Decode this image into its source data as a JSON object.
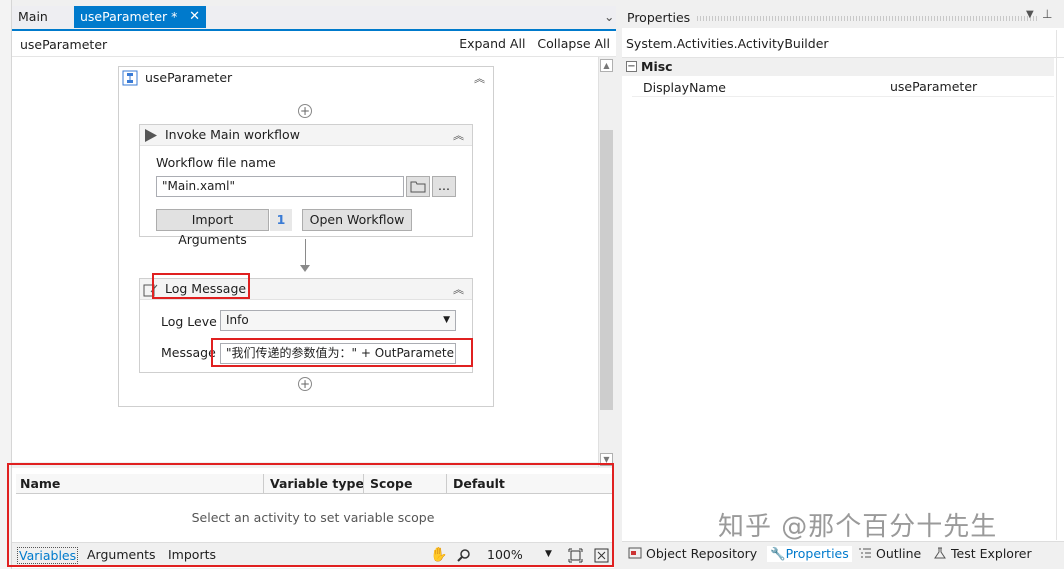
{
  "tabs": {
    "main": "Main",
    "active": "useParameter *",
    "close": "✕"
  },
  "designer": {
    "title": "useParameter",
    "expand_all": "Expand All",
    "collapse_all": "Collapse All"
  },
  "sequence": {
    "title": "useParameter",
    "invoke": {
      "title": "Invoke Main workflow",
      "file_label": "Workflow file name",
      "file_value": "\"Main.xaml\"",
      "browse": "...",
      "import_btn": "Import Arguments",
      "import_count": "1",
      "open_btn": "Open Workflow"
    },
    "log": {
      "title": "Log Message",
      "level_label": "Log Leve",
      "level_value": "Info",
      "message_label": "Message",
      "message_value": "\"我们传递的参数值为：\" + OutParameter"
    }
  },
  "variables": {
    "columns": [
      "Name",
      "Variable type",
      "Scope",
      "Default"
    ],
    "empty_message": "Select an activity to set variable scope",
    "tabs": [
      "Variables",
      "Arguments",
      "Imports"
    ],
    "zoom": "100%"
  },
  "properties": {
    "title": "Properties",
    "object": "System.Activities.ActivityBuilder",
    "category": "Misc",
    "rows": [
      {
        "key": "DisplayName",
        "value": "useParameter"
      }
    ]
  },
  "bottom_tabs": [
    "Object Repository",
    "Properties",
    "Outline",
    "Test Explorer"
  ],
  "watermark": "知乎 @那个百分十先生",
  "colors": {
    "accent": "#007acc",
    "highlight": "#e02020"
  }
}
